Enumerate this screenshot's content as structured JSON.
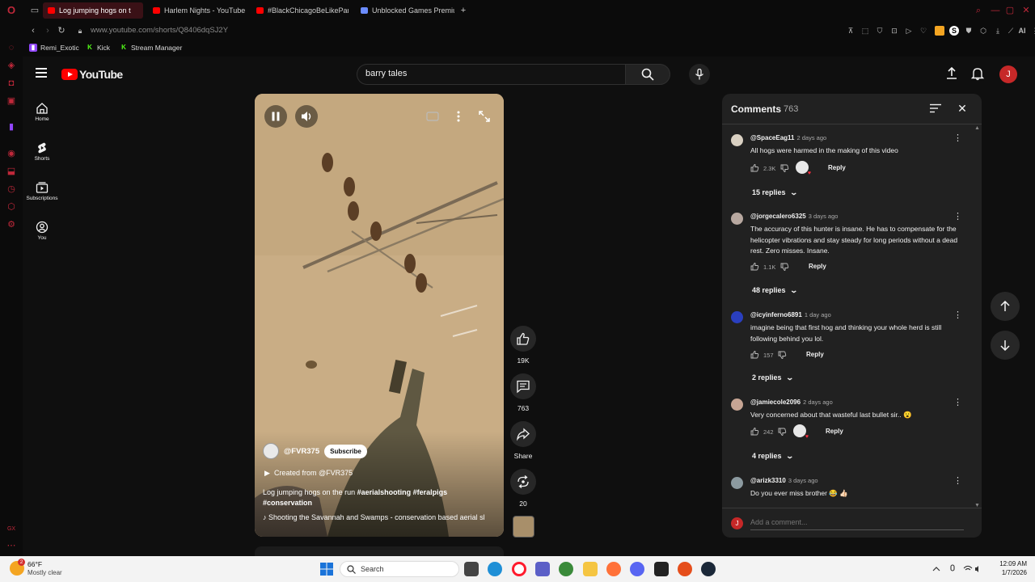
{
  "browser": {
    "tabs": [
      {
        "title": "Log jumping hogs on t",
        "active": true
      },
      {
        "title": "Harlem Nights - YouTube",
        "active": false
      },
      {
        "title": "#BlackChicagoBeLikePart",
        "active": false
      },
      {
        "title": "Unblocked Games Premium",
        "active": false
      }
    ],
    "new_tab": "+",
    "url": "www.youtube.com/shorts/Q8406dqSJ2Y",
    "ai_label": "AI",
    "bookmarks": [
      "Remi_Exotic",
      "Kick",
      "Stream Manager"
    ]
  },
  "youtube": {
    "logo_text": "YouTube",
    "search_value": "barry tales",
    "avatar_letter": "J",
    "guide": [
      {
        "label": "Home",
        "icon": "home-icon"
      },
      {
        "label": "Shorts",
        "icon": "shorts-icon"
      },
      {
        "label": "Subscriptions",
        "icon": "subscriptions-icon"
      },
      {
        "label": "You",
        "icon": "you-icon"
      }
    ]
  },
  "short": {
    "channel": "@FVR375",
    "subscribe_label": "Subscribe",
    "created_from": "Created from @FVR375",
    "caption_text": "Log jumping hogs on the run ",
    "caption_tags": "#aerialshooting #feralpigs #conservation",
    "sound": "Shooting the Savannah and Swamps - conservation based aerial sl",
    "likes": "19K",
    "comments": "763",
    "share_label": "Share",
    "remix_count": "20"
  },
  "comments_panel": {
    "title": "Comments",
    "count": "763",
    "add_placeholder": "Add a comment...",
    "self_avatar": "J",
    "items": [
      {
        "author": "@SpaceEag11",
        "time": "2 days ago",
        "text": "All hogs were harmed in the making of this video",
        "likes": "2.3K",
        "reply_label": "Reply",
        "hearted": true,
        "replies": "15 replies"
      },
      {
        "author": "@jorgecalero6325",
        "time": "3 days ago",
        "text": "The accuracy of this hunter is insane. He has to compensate for the helicopter vibrations and stay steady for long periods without a dead rest. Zero misses. Insane.",
        "likes": "1.1K",
        "reply_label": "Reply",
        "hearted": false,
        "replies": "48 replies"
      },
      {
        "author": "@icyinferno6891",
        "time": "1 day ago",
        "text": "imagine being that first hog and thinking your whole herd is still following behind you lol.",
        "likes": "157",
        "reply_label": "Reply",
        "hearted": false,
        "replies": "2 replies"
      },
      {
        "author": "@jamiecole2096",
        "time": "2 days ago",
        "text": "Very concerned about that wasteful last bullet sir.. 😮",
        "likes": "242",
        "reply_label": "Reply",
        "hearted": true,
        "replies": "4 replies"
      },
      {
        "author": "@arizk3310",
        "time": "3 days ago",
        "text": "Do you ever miss brother 😂 👍🏻",
        "likes": "",
        "reply_label": "Reply",
        "hearted": false,
        "replies": ""
      }
    ]
  },
  "taskbar": {
    "weather_badge": "2",
    "temp": "66°F",
    "condition": "Mostly clear",
    "search_label": "Search",
    "time": "12:09 AM",
    "date": "1/7/2026"
  },
  "colors": {
    "yt_red": "#ff0000",
    "opera_red": "#c0283a",
    "panel_bg": "#212121",
    "page_bg": "#0f0f0f"
  }
}
